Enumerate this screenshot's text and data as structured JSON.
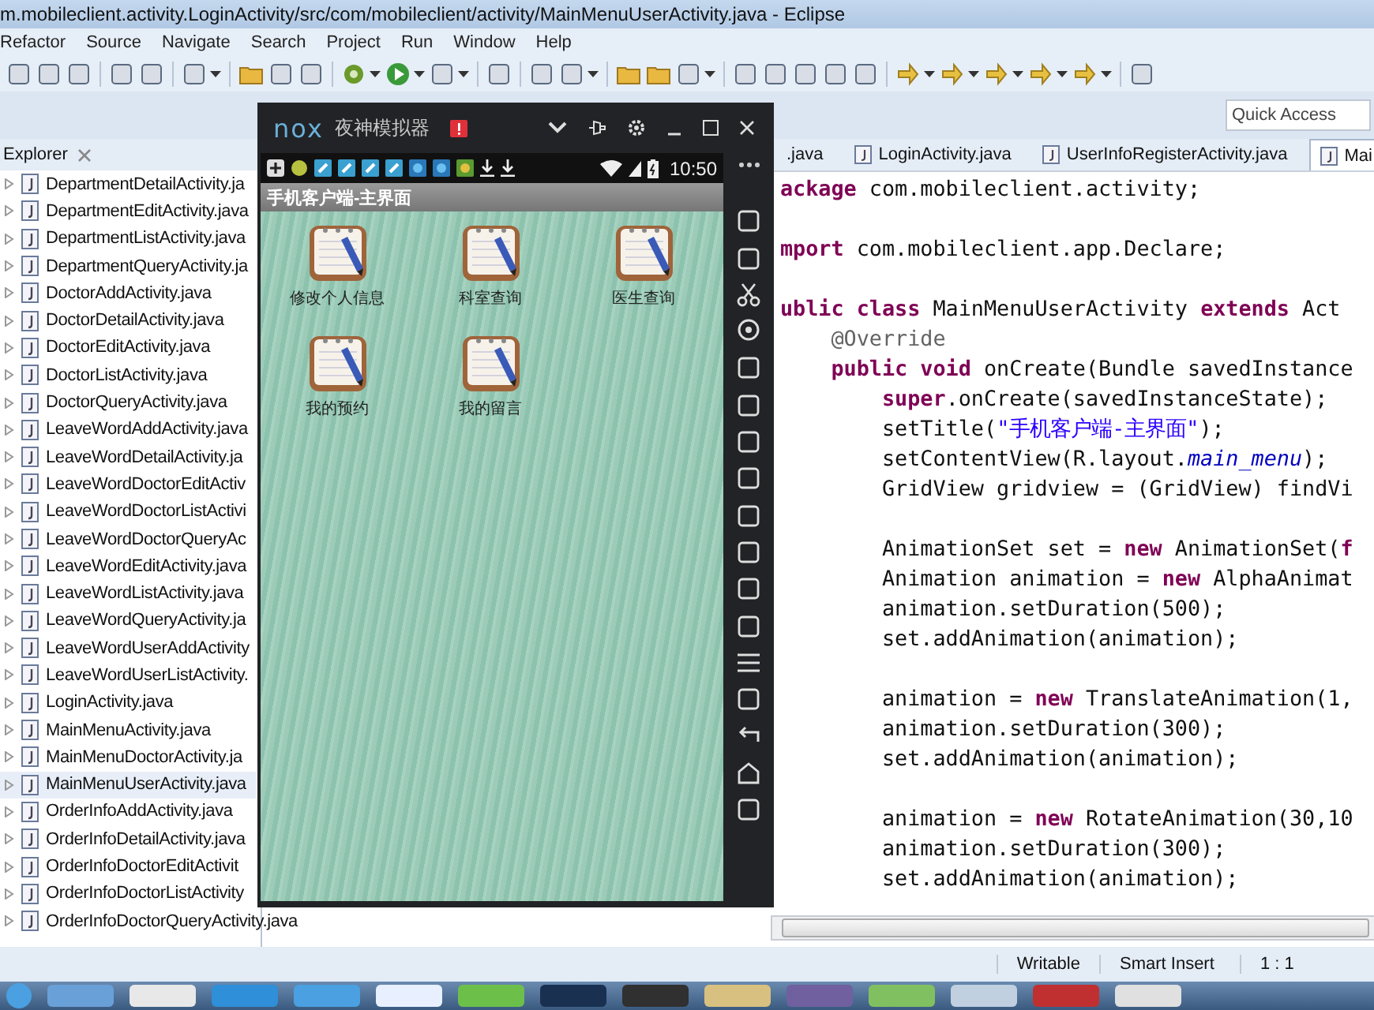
{
  "window": {
    "title": "m.mobileclient.activity.LoginActivity/src/com/mobileclient/activity/MainMenuUserActivity.java - Eclipse"
  },
  "menu": [
    "Refactor",
    "Source",
    "Navigate",
    "Search",
    "Project",
    "Run",
    "Window",
    "Help"
  ],
  "quick_access": {
    "placeholder": "Quick Access"
  },
  "explorer": {
    "title": "Explorer",
    "items": [
      {
        "label": "DepartmentDetailActivity.ja",
        "selected": false
      },
      {
        "label": "DepartmentEditActivity.java",
        "selected": false
      },
      {
        "label": "DepartmentListActivity.java",
        "selected": false
      },
      {
        "label": "DepartmentQueryActivity.ja",
        "selected": false
      },
      {
        "label": "DoctorAddActivity.java",
        "selected": false
      },
      {
        "label": "DoctorDetailActivity.java",
        "selected": false
      },
      {
        "label": "DoctorEditActivity.java",
        "selected": false
      },
      {
        "label": "DoctorListActivity.java",
        "selected": false
      },
      {
        "label": "DoctorQueryActivity.java",
        "selected": false
      },
      {
        "label": "LeaveWordAddActivity.java",
        "selected": false
      },
      {
        "label": "LeaveWordDetailActivity.ja",
        "selected": false
      },
      {
        "label": "LeaveWordDoctorEditActiv",
        "selected": false
      },
      {
        "label": "LeaveWordDoctorListActivi",
        "selected": false
      },
      {
        "label": "LeaveWordDoctorQueryAc",
        "selected": false
      },
      {
        "label": "LeaveWordEditActivity.java",
        "selected": false
      },
      {
        "label": "LeaveWordListActivity.java",
        "selected": false
      },
      {
        "label": "LeaveWordQueryActivity.ja",
        "selected": false
      },
      {
        "label": "LeaveWordUserAddActivity",
        "selected": false
      },
      {
        "label": "LeaveWordUserListActivity.",
        "selected": false
      },
      {
        "label": "LoginActivity.java",
        "selected": false
      },
      {
        "label": "MainMenuActivity.java",
        "selected": false
      },
      {
        "label": "MainMenuDoctorActivity.ja",
        "selected": false
      },
      {
        "label": "MainMenuUserActivity.java",
        "selected": true
      },
      {
        "label": "OrderInfoAddActivity.java",
        "selected": false
      },
      {
        "label": "OrderInfoDetailActivity.java",
        "selected": false
      },
      {
        "label": "OrderInfoDoctorEditActivit",
        "selected": false
      },
      {
        "label": "OrderInfoDoctorListActivity",
        "selected": false
      },
      {
        "label": "OrderInfoDoctorQueryActivity.java",
        "selected": false
      }
    ]
  },
  "editor": {
    "tabs": [
      {
        "label": ".java",
        "selected": false
      },
      {
        "label": "LoginActivity.java",
        "selected": false
      },
      {
        "label": "UserInfoRegisterActivity.java",
        "selected": false
      },
      {
        "label": "Mai",
        "selected": true
      }
    ],
    "lines": [
      {
        "kind": "code",
        "segments": [
          {
            "kind": "keyword",
            "text": "ackage"
          },
          {
            "kind": "plain",
            "text": " com.mobileclient.activity;"
          }
        ]
      },
      {
        "kind": "blank"
      },
      {
        "kind": "code",
        "segments": [
          {
            "kind": "keyword",
            "text": "mport"
          },
          {
            "kind": "plain",
            "text": " com.mobileclient.app.Declare;"
          }
        ]
      },
      {
        "kind": "blank"
      },
      {
        "kind": "code",
        "segments": [
          {
            "kind": "keyword",
            "text": "ublic class"
          },
          {
            "kind": "plain",
            "text": " MainMenuUserActivity "
          },
          {
            "kind": "keyword",
            "text": "extends"
          },
          {
            "kind": "plain",
            "text": " Act"
          }
        ]
      },
      {
        "kind": "code",
        "segments": [
          {
            "kind": "annotation",
            "text": "    @Override"
          }
        ]
      },
      {
        "kind": "code",
        "segments": [
          {
            "kind": "keyword",
            "text": "    public void"
          },
          {
            "kind": "plain",
            "text": " onCreate(Bundle savedInstance"
          }
        ]
      },
      {
        "kind": "code",
        "segments": [
          {
            "kind": "keyword",
            "text": "        super"
          },
          {
            "kind": "plain",
            "text": ".onCreate(savedInstanceState);"
          }
        ]
      },
      {
        "kind": "code",
        "segments": [
          {
            "kind": "plain",
            "text": "        setTitle("
          },
          {
            "kind": "string",
            "text": "\"手机客户端-主界面\""
          },
          {
            "kind": "plain",
            "text": ");"
          }
        ]
      },
      {
        "kind": "code",
        "segments": [
          {
            "kind": "plain",
            "text": "        setContentView(R.layout."
          },
          {
            "kind": "field",
            "text": "main_menu"
          },
          {
            "kind": "plain",
            "text": ");"
          }
        ]
      },
      {
        "kind": "code",
        "segments": [
          {
            "kind": "plain",
            "text": "        GridView gridview = (GridView) findVi"
          }
        ]
      },
      {
        "kind": "blank"
      },
      {
        "kind": "code",
        "segments": [
          {
            "kind": "plain",
            "text": "        AnimationSet set = "
          },
          {
            "kind": "keyword",
            "text": "new"
          },
          {
            "kind": "plain",
            "text": " AnimationSet("
          },
          {
            "kind": "keyword",
            "text": "f"
          }
        ]
      },
      {
        "kind": "code",
        "segments": [
          {
            "kind": "plain",
            "text": "        Animation animation = "
          },
          {
            "kind": "keyword",
            "text": "new"
          },
          {
            "kind": "plain",
            "text": " AlphaAnimat"
          }
        ]
      },
      {
        "kind": "code",
        "segments": [
          {
            "kind": "plain",
            "text": "        animation.setDuration(500);"
          }
        ]
      },
      {
        "kind": "code",
        "segments": [
          {
            "kind": "plain",
            "text": "        set.addAnimation(animation);"
          }
        ]
      },
      {
        "kind": "blank"
      },
      {
        "kind": "code",
        "segments": [
          {
            "kind": "plain",
            "text": "        animation = "
          },
          {
            "kind": "keyword",
            "text": "new"
          },
          {
            "kind": "plain",
            "text": " TranslateAnimation(1,"
          }
        ]
      },
      {
        "kind": "code",
        "segments": [
          {
            "kind": "plain",
            "text": "        animation.setDuration(300);"
          }
        ]
      },
      {
        "kind": "code",
        "segments": [
          {
            "kind": "plain",
            "text": "        set.addAnimation(animation);"
          }
        ]
      },
      {
        "kind": "blank"
      },
      {
        "kind": "code",
        "segments": [
          {
            "kind": "plain",
            "text": "        animation = "
          },
          {
            "kind": "keyword",
            "text": "new"
          },
          {
            "kind": "plain",
            "text": " RotateAnimation(30,10"
          }
        ]
      },
      {
        "kind": "code",
        "segments": [
          {
            "kind": "plain",
            "text": "        animation.setDuration(300);"
          }
        ]
      },
      {
        "kind": "code",
        "segments": [
          {
            "kind": "plain",
            "text": "        set.addAnimation(animation);"
          }
        ]
      }
    ]
  },
  "emulator": {
    "logo": "nox",
    "title": "夜神模拟器",
    "time": "10:50",
    "app_title": "手机客户端-主界面",
    "menu_items": [
      {
        "label": "修改个人信息"
      },
      {
        "label": "科室查询"
      },
      {
        "label": "医生查询"
      },
      {
        "label": "我的预约"
      },
      {
        "label": "我的留言"
      }
    ]
  },
  "status_bar": [
    "Writable",
    "Smart Insert",
    "1 : 1"
  ]
}
